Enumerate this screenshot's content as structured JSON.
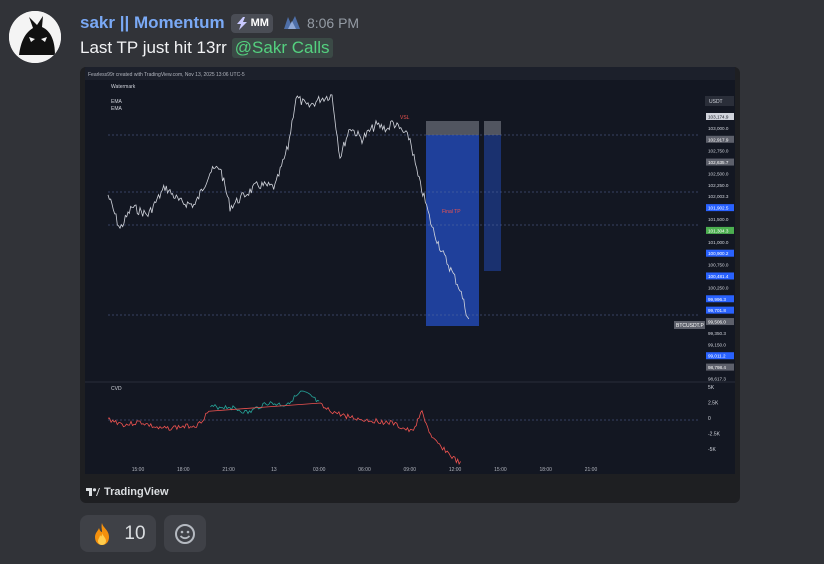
{
  "message": {
    "username": "sakr || Momentum",
    "tag": "MM",
    "timestamp": "8:06 PM",
    "text": "Last TP just hit 13rr",
    "mention": "@Sakr Calls"
  },
  "embed": {
    "provider": "TradingView",
    "header_text": "Fearless99r created with TradingView.com, Nov 13, 2025 13:06 UTC-5",
    "watermark": "Watermark",
    "indicators": [
      "EMA",
      "EMA"
    ],
    "currency": "USDT",
    "symbol_tag": "BTCUSDT.P",
    "labels": {
      "vsl": "VSL",
      "final_tp": "Final TP"
    },
    "cvd_label": "CVD",
    "price_ticks": [
      "103,174.9",
      "103,000.0",
      "102,917.9",
      "102,750.0",
      "102,635.7",
      "102,500.0",
      "102,250.0",
      "102,003.3",
      "101,902.5",
      "101,500.0",
      "101,304.3",
      "101,000.0",
      "100,900.2",
      "100,750.0",
      "100,481.4",
      "100,250.0",
      "99,996.3",
      "99,701.8",
      "99,506.0",
      "99,350.3",
      "99,150.0",
      "99,011.2",
      "98,798.4",
      "98,617.3"
    ],
    "cvd_ticks": [
      "5K",
      "2.5K",
      "0",
      "-2.5K",
      "-5K"
    ],
    "time_ticks": [
      "15:00",
      "18:00",
      "21:00",
      "13",
      "03:00",
      "06:00",
      "09:00",
      "12:00",
      "15:00",
      "18:00",
      "21:00"
    ]
  },
  "reactions": [
    {
      "emoji": "fire",
      "count": "10"
    }
  ],
  "colors": {
    "background": "#313338",
    "username": "#7aa9f5",
    "mention_text": "#54d17f",
    "chart_bg": "#131722",
    "tp_zone": "#2962ff",
    "price_line": "#d1d4dc",
    "cvd_up": "#26a69a",
    "cvd_down": "#ef5350"
  }
}
